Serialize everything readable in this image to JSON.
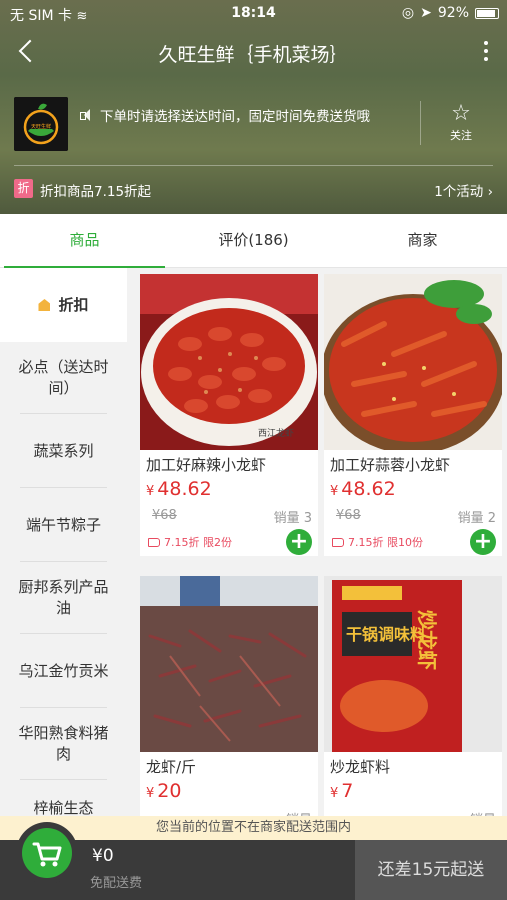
{
  "status": {
    "carrier": "无 SIM 卡",
    "time": "18:14",
    "battery": "92%"
  },
  "header": {
    "title": "久旺生鲜｛手机菜场｝",
    "notice": "下单时请选择送达时间，固定时间免费送货哦",
    "follow_label": "关注",
    "logo_text": "天旺生鲜"
  },
  "promo": {
    "badge": "折",
    "text": "折扣商品7.15折起",
    "activities": "1个活动 ›"
  },
  "tabs": [
    {
      "label": "商品",
      "active": true
    },
    {
      "label": "评价(186)",
      "active": false
    },
    {
      "label": "商家",
      "active": false
    }
  ],
  "categories": [
    {
      "label": "折扣"
    },
    {
      "label": "必点（送达时间）"
    },
    {
      "label": "蔬菜系列"
    },
    {
      "label": "端午节粽子"
    },
    {
      "label": "厨邦系列产品油"
    },
    {
      "label": "乌江金竹贡米"
    },
    {
      "label": "华阳熟食料猪肉"
    },
    {
      "label": "梓榆生态"
    }
  ],
  "products": [
    {
      "name": "加工好麻辣小龙虾",
      "currency": "¥",
      "price": "48.62",
      "original": "¥68",
      "sales": "销量 3",
      "promo": "7.15折 限2份",
      "image_text": "西江龙虾"
    },
    {
      "name": "加工好蒜蓉小龙虾",
      "currency": "¥",
      "price": "48.62",
      "original": "¥68",
      "sales": "销量 2",
      "promo": "7.15折 限10份"
    },
    {
      "name": "龙虾/斤",
      "currency": "¥",
      "price": "20",
      "original": "",
      "sales": "销量",
      "promo": ""
    },
    {
      "name": "炒龙虾料",
      "currency": "¥",
      "price": "7",
      "original": "",
      "sales": "销量",
      "promo": "",
      "image_text1": "炒龙虾",
      "image_text2": "干锅调味料"
    }
  ],
  "notice_bar": "您当前的位置不在商家配送范围内",
  "cart": {
    "total": "¥0",
    "free_delivery": "免配送费",
    "checkout": "还差15元起送"
  },
  "colors": {
    "accent": "#2fad3a",
    "price": "#e03030"
  }
}
